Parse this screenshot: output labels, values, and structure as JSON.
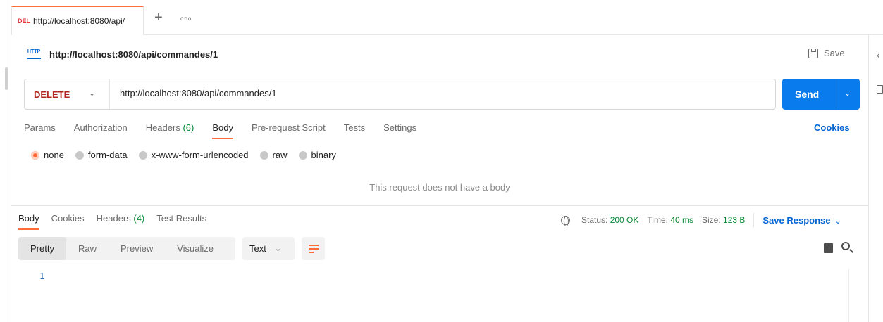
{
  "tab": {
    "method": "DEL",
    "title": "http://localhost:8080/api/",
    "new_tab": "+",
    "more": "ooo"
  },
  "request": {
    "icon_text": "HTTP",
    "title": "http://localhost:8080/api/commandes/1",
    "save_label": "Save",
    "method": "DELETE",
    "url": "http://localhost:8080/api/commandes/1",
    "send_label": "Send"
  },
  "request_tabs": [
    {
      "label": "Params"
    },
    {
      "label": "Authorization"
    },
    {
      "label": "Headers",
      "count": "(6)"
    },
    {
      "label": "Body",
      "active": true
    },
    {
      "label": "Pre-request Script"
    },
    {
      "label": "Tests"
    },
    {
      "label": "Settings"
    }
  ],
  "cookies_link": "Cookies",
  "body_options": {
    "selected": "none",
    "options": [
      "none",
      "form-data",
      "x-www-form-urlencoded",
      "raw",
      "binary"
    ]
  },
  "empty_body_text": "This request does not have a body",
  "response_tabs": [
    {
      "label": "Body",
      "active": true
    },
    {
      "label": "Cookies"
    },
    {
      "label": "Headers",
      "count": "(4)"
    },
    {
      "label": "Test Results"
    }
  ],
  "response_status": {
    "status_label": "Status:",
    "status_value": "200 OK",
    "time_label": "Time:",
    "time_value": "40 ms",
    "size_label": "Size:",
    "size_value": "123 B",
    "save_response": "Save Response"
  },
  "response_views": [
    "Pretty",
    "Raw",
    "Preview",
    "Visualize"
  ],
  "response_active_view": "Pretty",
  "response_format": "Text",
  "editor": {
    "line_numbers": [
      "1"
    ]
  },
  "colors": {
    "accent": "#ff6c37",
    "send_button": "#097bed",
    "link": "#0265d2",
    "status_ok": "#078834",
    "method_delete": "#b3261e"
  },
  "icons": {
    "tab_more": "more-horizontal-icon",
    "save": "save-icon",
    "globe": "globe-icon",
    "copy": "copy-icon",
    "search": "search-icon",
    "wrap": "wrap-lines-icon"
  }
}
